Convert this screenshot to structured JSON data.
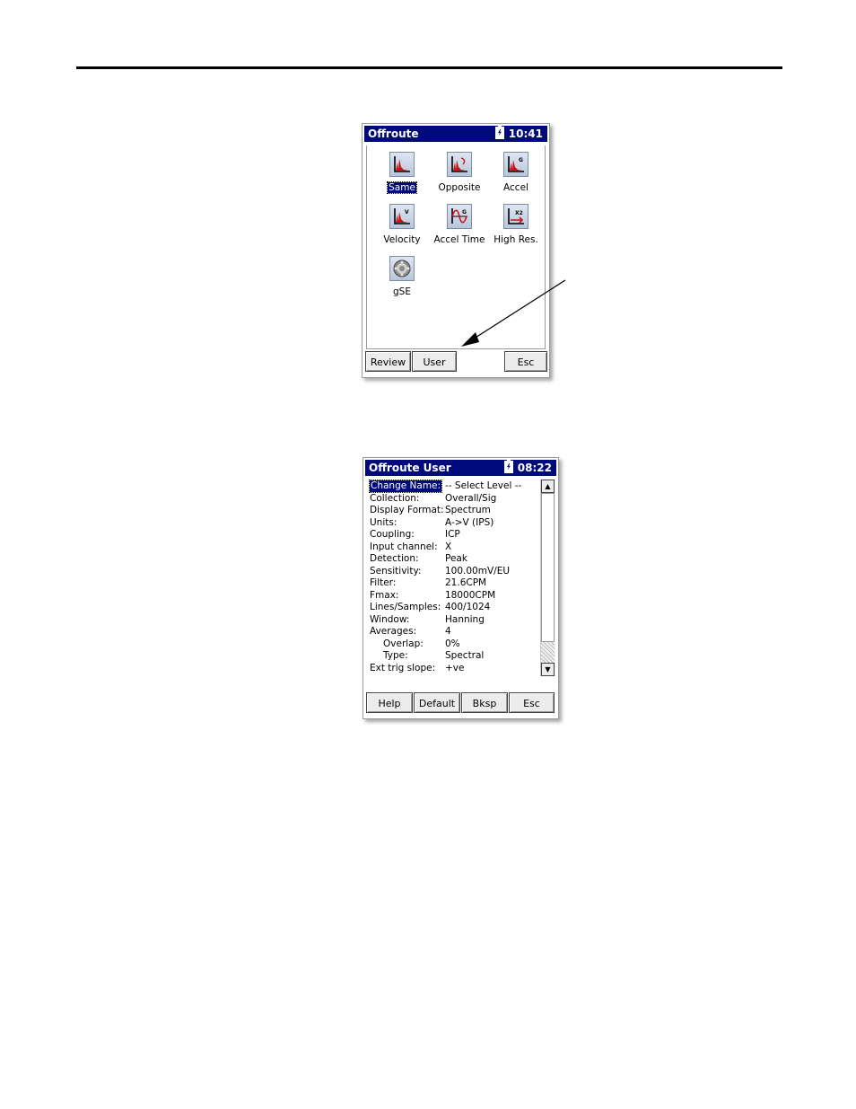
{
  "window1": {
    "title": "Offroute",
    "time": "10:41",
    "icons": [
      {
        "label": "Same",
        "icon": "spectrum-same-icon",
        "selected": true
      },
      {
        "label": "Opposite",
        "icon": "spectrum-opposite-icon"
      },
      {
        "label": "Accel",
        "icon": "spectrum-accel-icon"
      },
      {
        "label": "Velocity",
        "icon": "spectrum-velocity-icon"
      },
      {
        "label": "Accel Time",
        "icon": "waveform-accel-time-icon"
      },
      {
        "label": "High Res.",
        "icon": "high-res-icon"
      },
      {
        "label": "gSE",
        "icon": "gse-bearing-icon"
      }
    ],
    "buttons": {
      "review": "Review",
      "user": "User",
      "esc": "Esc"
    }
  },
  "window2": {
    "title": "Offroute User",
    "time": "08:22",
    "rows": [
      {
        "key": "Change Name:",
        "value": "-- Select Level --"
      },
      {
        "key": "Collection:",
        "value": "Overall/Sig"
      },
      {
        "key": "Display Format:",
        "value": "Spectrum"
      },
      {
        "key": "Units:",
        "value": "A->V (IPS)"
      },
      {
        "key": "Coupling:",
        "value": "ICP"
      },
      {
        "key": "Input channel:",
        "value": "X"
      },
      {
        "key": "Detection:",
        "value": "Peak"
      },
      {
        "key": "Sensitivity:",
        "value": "100.00mV/EU"
      },
      {
        "key": "Filter:",
        "value": "21.6CPM"
      },
      {
        "key": "Fmax:",
        "value": "18000CPM"
      },
      {
        "key": "Lines/Samples:",
        "value": "400/1024"
      },
      {
        "key": "Window:",
        "value": "Hanning"
      },
      {
        "key": "Averages:",
        "value": "4"
      },
      {
        "key": "Overlap:",
        "value": "0%"
      },
      {
        "key": "Type:",
        "value": "Spectral"
      },
      {
        "key": "Ext trig slope:",
        "value": "+ve"
      }
    ],
    "buttons": {
      "help": "Help",
      "default": "Default",
      "bksp": "Bksp",
      "esc": "Esc"
    }
  },
  "colors": {
    "titlebar": "#000a7a",
    "selection": "#000a7a",
    "spectrum_red": "#cc1111"
  }
}
